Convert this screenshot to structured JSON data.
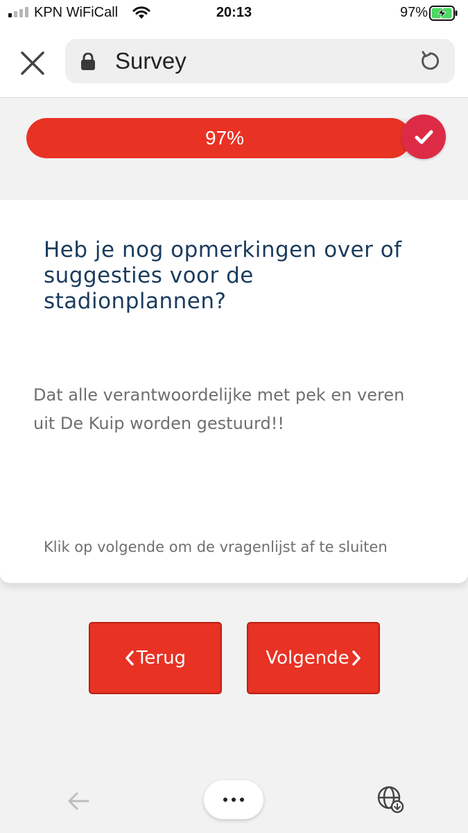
{
  "status_bar": {
    "carrier": "KPN WiFiCall",
    "time": "20:13",
    "battery_percent": "97%",
    "signal_bars_active": 1,
    "signal_bars_total": 4,
    "battery_level": 0.97,
    "battery_charging": true
  },
  "browser": {
    "page_title": "Survey",
    "icons": [
      "close-icon",
      "lock-icon",
      "reload-icon"
    ]
  },
  "progress": {
    "label": "97%",
    "value": 0.97,
    "fill_color": "#e83224",
    "check_color": "#dd2b45"
  },
  "question": {
    "title": "Heb je nog opmerkingen over of suggesties voor de stadionplannen?",
    "answer": "Dat alle verantwoordelijke met pek en veren uit De Kuip worden gestuurd!!",
    "note": "Klik op volgende om de vragenlijst af te sluiten"
  },
  "buttons": {
    "back_label": "Terug",
    "next_label": "Volgende",
    "color": "#e83224"
  },
  "bottom_nav": {
    "icons": [
      "back-arrow-icon",
      "more-icon",
      "globe-icon"
    ]
  },
  "colors": {
    "accent": "#e83224",
    "heading": "#1a3b5c",
    "body_text": "#6f6f6f"
  }
}
